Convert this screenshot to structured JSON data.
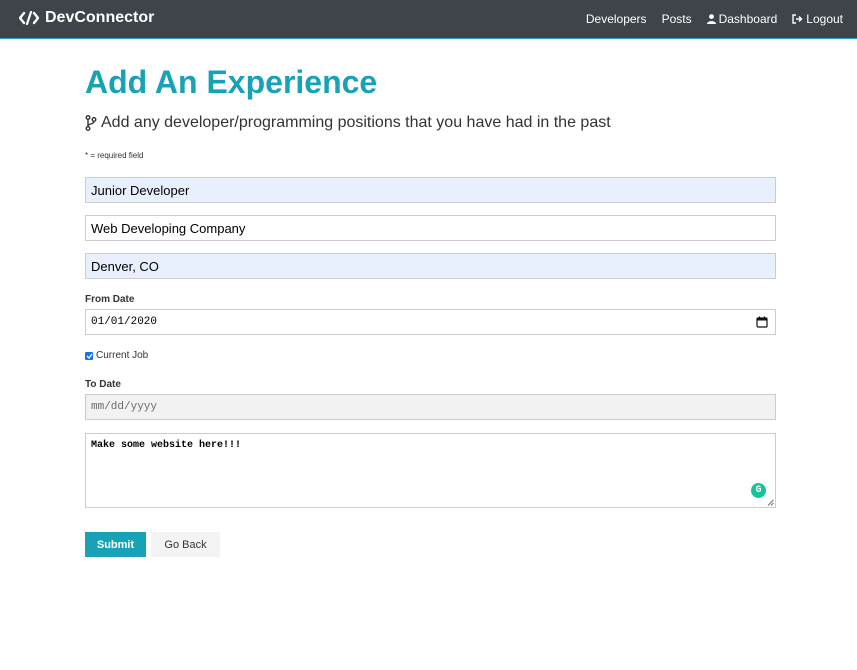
{
  "navbar": {
    "brand_label": "DevConnector",
    "links": [
      {
        "label": "Developers"
      },
      {
        "label": "Posts"
      },
      {
        "label": "Dashboard",
        "icon": "user-icon"
      },
      {
        "label": "Logout",
        "icon": "sign-out-icon"
      }
    ]
  },
  "page": {
    "title": "Add An Experience",
    "lead": "Add any developer/programming positions that you have had in the past",
    "required_note": "* = required field"
  },
  "form": {
    "job_title_value": "Junior Developer",
    "company_value": "Web Developing Company",
    "location_value": "Denver, CO",
    "from_date_label": "From Date",
    "from_date_value": "01/01/2020",
    "current_job_label": "Current Job",
    "current_job_checked": true,
    "to_date_label": "To Date",
    "to_date_placeholder": "mm/dd/yyyy",
    "description_value": "Make some website here!!!",
    "submit_label": "Submit",
    "go_back_label": "Go Back"
  },
  "colors": {
    "accent": "#17a2b8",
    "navbar_bg": "#343a40",
    "autofill_bg": "#e8f0fe",
    "grammarly": "#15c39a"
  }
}
